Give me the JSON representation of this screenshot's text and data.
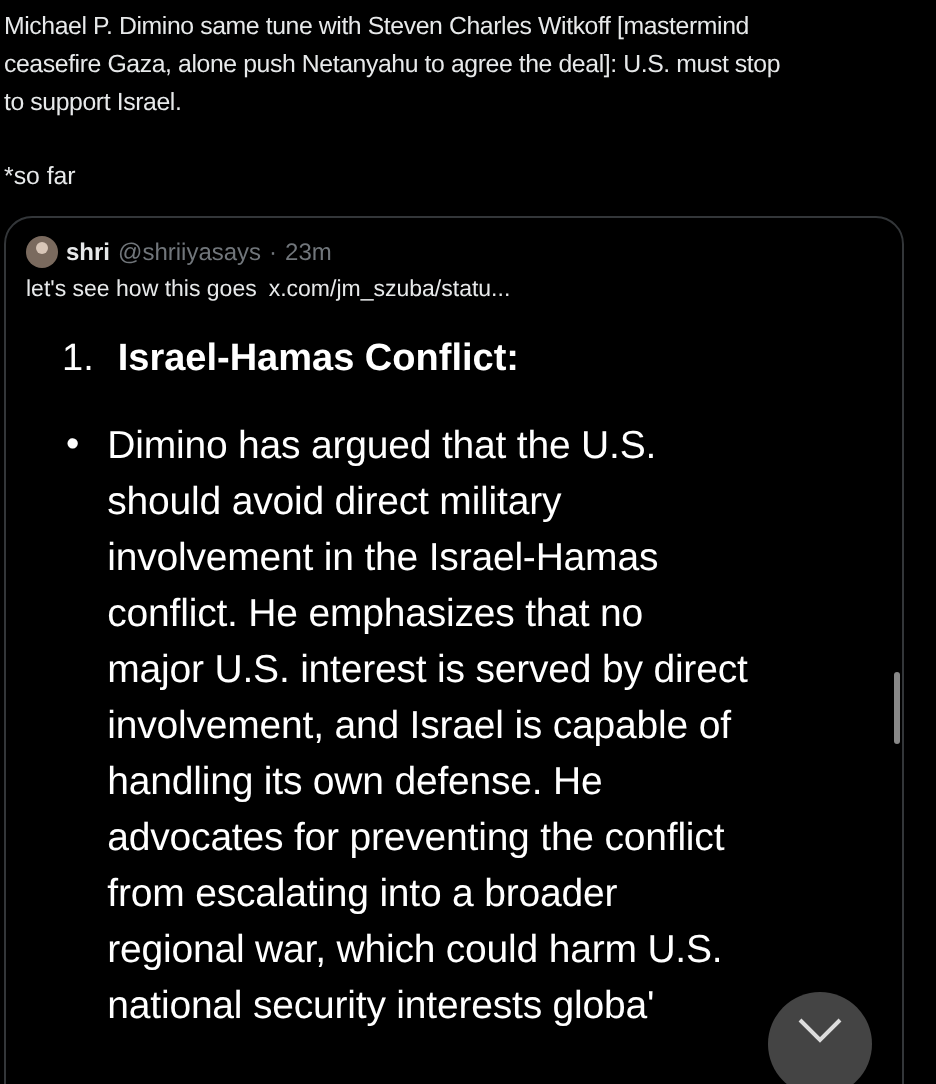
{
  "post": {
    "lines": [
      "Michael P. Dimino same tune with Steven Charles Witkoff [mastermind",
      "ceasefire Gaza, alone push Netanyahu to agree the deal]: U.S. must stop",
      "to support Israel."
    ],
    "footnote": "*so far"
  },
  "quote": {
    "name": "shri",
    "handle": "@shriiyasays",
    "separator": "·",
    "time": "23m",
    "text": "let's see how this goes",
    "link": "x.com/jm_szuba/statu..."
  },
  "image": {
    "heading_number": "1.",
    "heading": "Israel-Hamas Conflict:",
    "bullet": "•",
    "lines": [
      "Dimino has argued that the U.S.",
      "should avoid direct military",
      "involvement in the Israel-Hamas",
      "conflict. He emphasizes that no",
      "major U.S. interest is served by direct",
      "involvement, and Israel is capable of",
      "handling its own defense. He",
      "advocates for preventing the conflict",
      "from escalating into a broader",
      "regional war, which could harm U.S.",
      "national security interests globa'"
    ]
  }
}
